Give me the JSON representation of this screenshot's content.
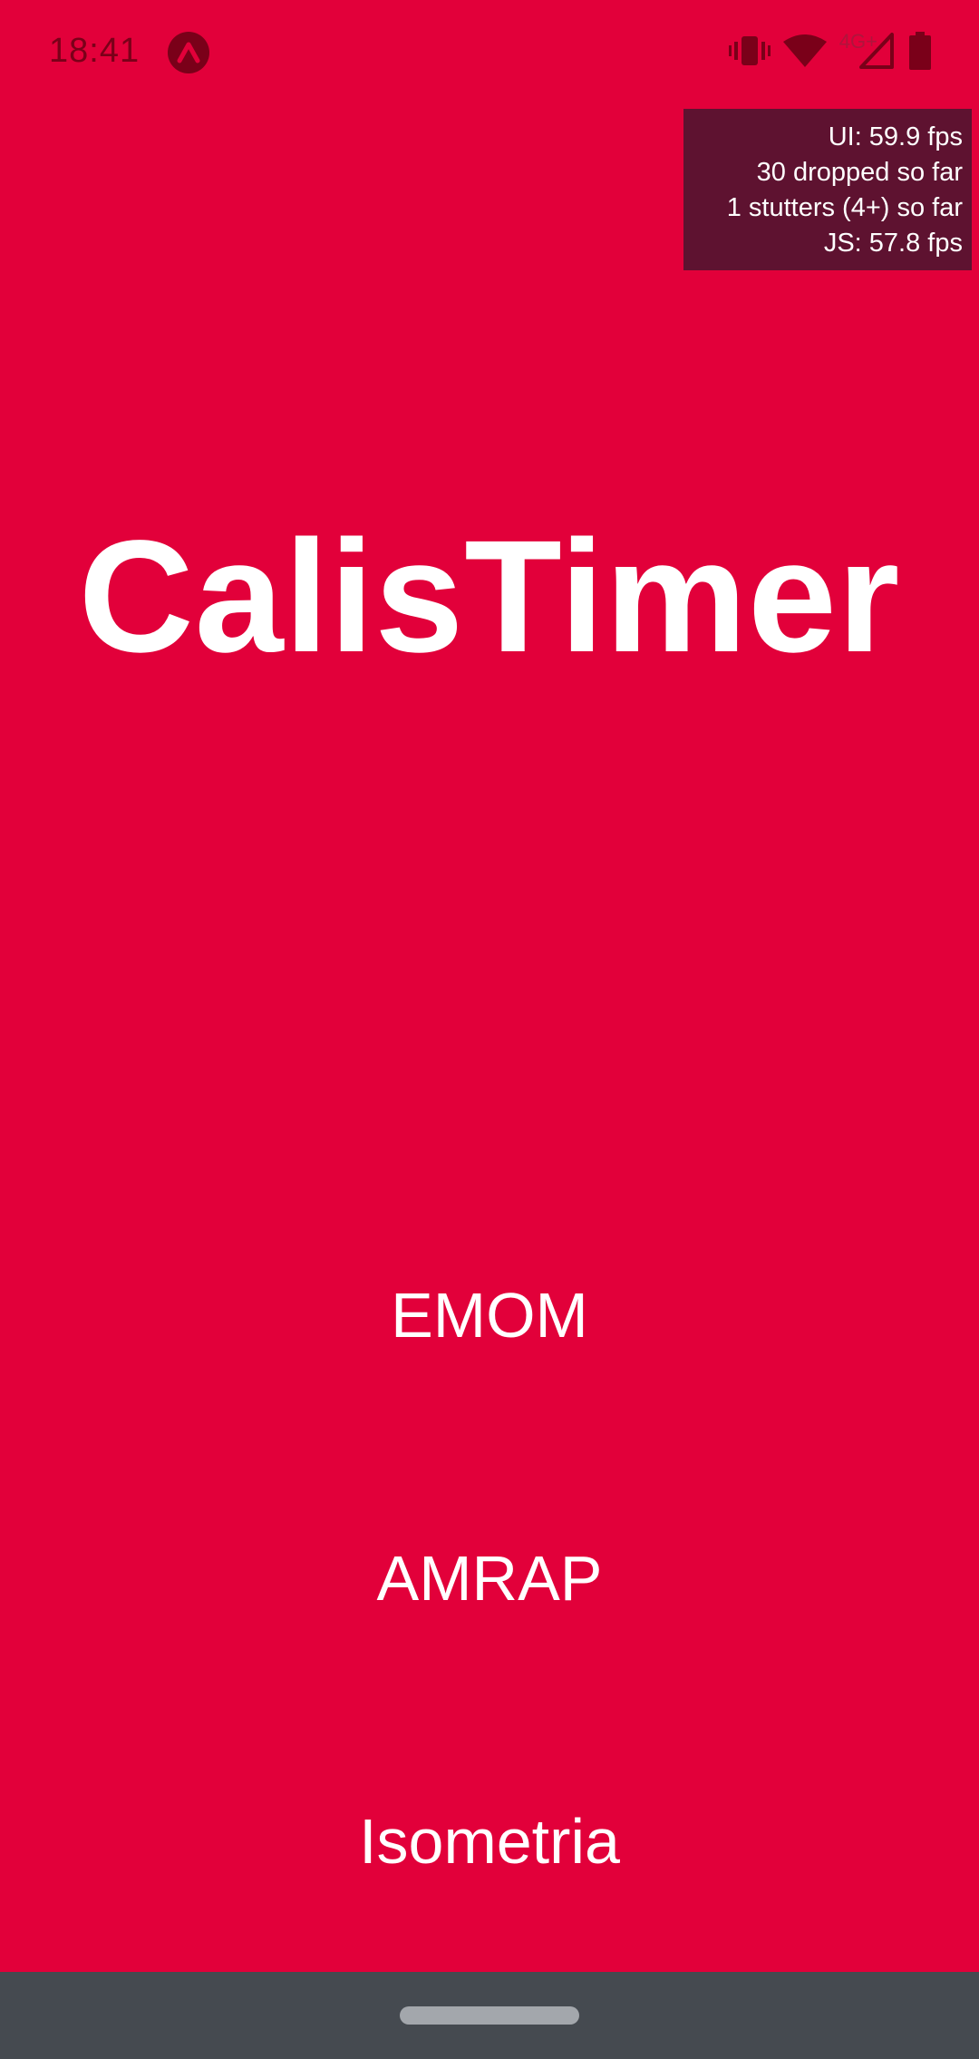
{
  "status_bar": {
    "time": "18:41",
    "app_icon": "expo-icon",
    "icons": [
      "vibrate-icon",
      "wifi-icon",
      "cell-signal-icon",
      "battery-icon"
    ],
    "network_label": "4G+",
    "icon_color": "#7a0019"
  },
  "perf_monitor": {
    "ui_fps": "UI: 59.9 fps",
    "dropped": "30 dropped so far",
    "stutters": "1 stutters (4+) so far",
    "js_fps": "JS: 57.8 fps"
  },
  "app": {
    "title": "CalisTimer",
    "background_color": "#e2003a"
  },
  "modes": [
    {
      "label": "EMOM"
    },
    {
      "label": "AMRAP"
    },
    {
      "label": "Isometria"
    }
  ],
  "nav_bar": {
    "handle": "gesture-handle",
    "color": "#454a50"
  }
}
